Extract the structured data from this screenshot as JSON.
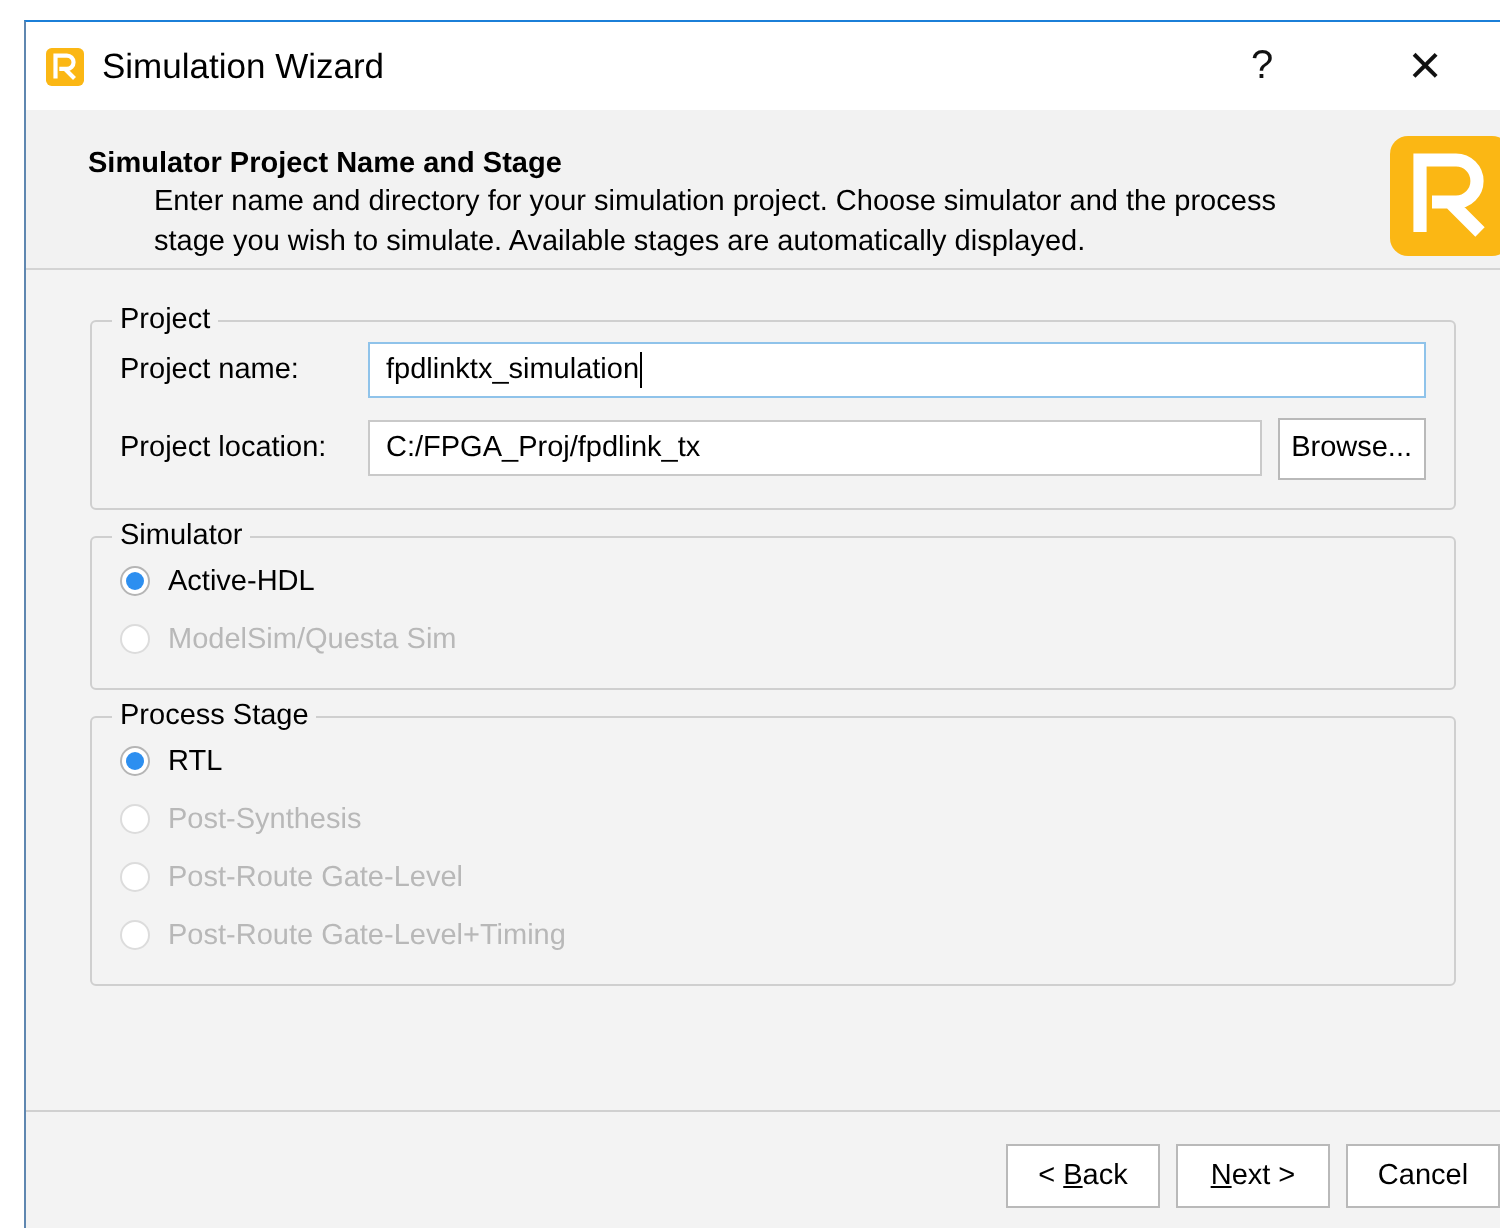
{
  "window": {
    "title": "Simulation Wizard",
    "help": "?",
    "close": "×"
  },
  "header": {
    "title": "Simulator Project Name and Stage",
    "description": "Enter name and directory for your simulation project. Choose simulator and the process stage you wish to simulate. Available stages are automatically displayed."
  },
  "project": {
    "legend": "Project",
    "name_label": "Project name:",
    "name_value": "fpdlinktx_simulation",
    "name_focused": true,
    "location_label": "Project location:",
    "location_value": "C:/FPGA_Proj/fpdlink_tx",
    "browse": "Browse..."
  },
  "simulator": {
    "legend": "Simulator",
    "options": [
      {
        "label": "Active-HDL",
        "selected": true,
        "disabled": false
      },
      {
        "label": "ModelSim/Questa Sim",
        "selected": false,
        "disabled": true
      }
    ]
  },
  "process_stage": {
    "legend": "Process Stage",
    "options": [
      {
        "label": "RTL",
        "selected": true,
        "disabled": false
      },
      {
        "label": "Post-Synthesis",
        "selected": false,
        "disabled": true
      },
      {
        "label": "Post-Route Gate-Level",
        "selected": false,
        "disabled": true
      },
      {
        "label": "Post-Route Gate-Level+Timing",
        "selected": false,
        "disabled": true
      }
    ]
  },
  "buttons": [
    {
      "before": "< ",
      "key": "B",
      "after": "ack"
    },
    {
      "key": "N",
      "after": "ext >"
    },
    {
      "before": "Cancel"
    }
  ]
}
